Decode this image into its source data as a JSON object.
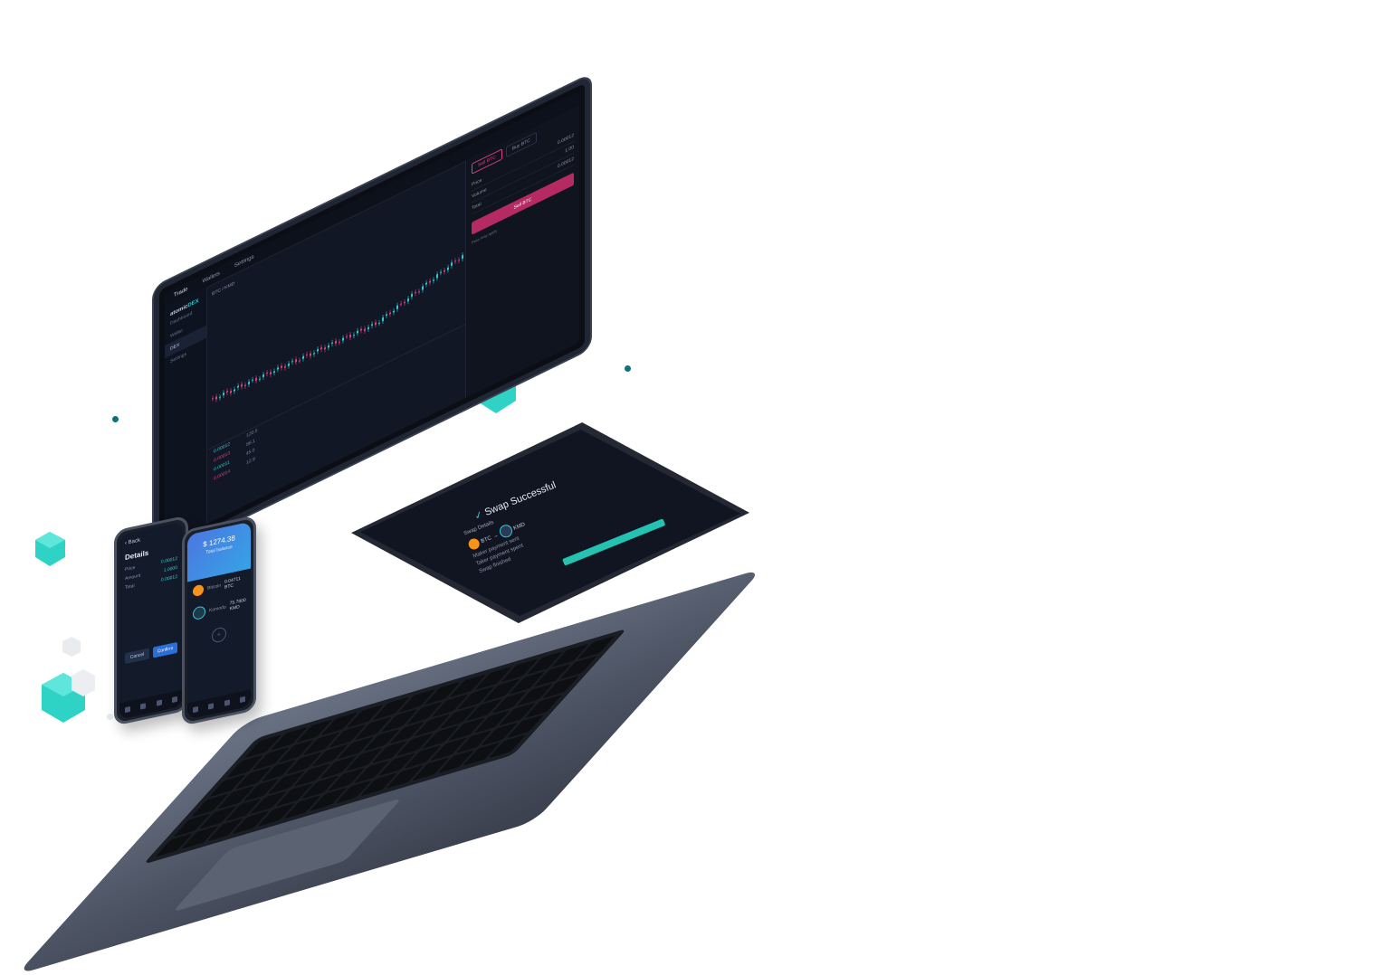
{
  "laptop": {
    "tabs": [
      "Trade",
      "Wallets",
      "Settings"
    ],
    "brand": {
      "name": "atomic",
      "accent": "DEX"
    },
    "sidebar": [
      "Dashboard",
      "Wallet",
      "DEX",
      "Settings"
    ],
    "chart_header": "BTC / KMD",
    "orderbook": [
      {
        "price": "0.00012",
        "amount": "120.5",
        "side": "buy"
      },
      {
        "price": "0.00013",
        "amount": "88.1",
        "side": "sell"
      },
      {
        "price": "0.00011",
        "amount": "45.0",
        "side": "buy"
      },
      {
        "price": "0.00014",
        "amount": "12.9",
        "side": "sell"
      }
    ],
    "right_panel": {
      "tab_sell": "Sell BTC",
      "tab_buy": "Buy BTC",
      "fields": [
        {
          "label": "Price",
          "value": "0.00012"
        },
        {
          "label": "Volume",
          "value": "1.00"
        },
        {
          "label": "Total",
          "value": "0.00012"
        }
      ],
      "sell_button": "Sell BTC",
      "note": "Fees may apply"
    }
  },
  "tablet": {
    "title": "Swap Successful",
    "subtitle": "Swap Details",
    "from_label": "BTC",
    "to_label": "KMD",
    "lines": [
      "Maker payment sent",
      "Taker payment spent",
      "Swap finished"
    ]
  },
  "phone_details": {
    "back": "‹ Back",
    "title": "Details",
    "rows": [
      {
        "label": "Price",
        "value": "0.00012"
      },
      {
        "label": "Amount",
        "value": "1.0000"
      },
      {
        "label": "Total",
        "value": "0.00012"
      }
    ],
    "cancel": "Cancel",
    "confirm": "Confirm"
  },
  "phone_wallet": {
    "balance": "$ 1274.38",
    "balance_caption": "Total balance",
    "coins": [
      {
        "name": "Bitcoin",
        "amount": "0.04711 BTC",
        "icon": "btc-icon"
      },
      {
        "name": "Komodo",
        "amount": "75.7800 KMD",
        "icon": "kmd-icon"
      }
    ],
    "add_symbol": "+"
  },
  "colors": {
    "accent": "#37c8d0",
    "sell": "#d8427f",
    "cube": "#2ed3c6"
  }
}
